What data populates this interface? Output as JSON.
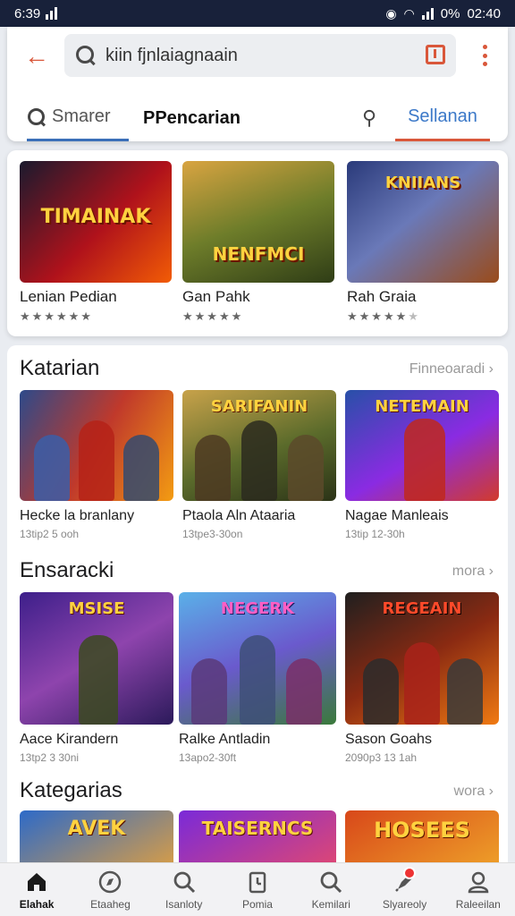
{
  "status_bar": {
    "time": "6:39",
    "battery": "0%",
    "clock": "02:40"
  },
  "header": {
    "search_value": "kiin fjnlaiagnaain",
    "tabs": {
      "search_label": "Smarer",
      "pencarian_label": "PPencarian",
      "sellanan_label": "Sellanan"
    }
  },
  "featured": {
    "items": [
      {
        "art": "TIMAINAK",
        "title": "Lenian Pedian",
        "rating": 5
      },
      {
        "art": "NENFMCI",
        "title": "Gan Pahk",
        "rating": 5
      },
      {
        "art": "KNIIANS",
        "title": "Rah Graia",
        "rating": 4.5
      }
    ]
  },
  "sections": [
    {
      "title": "Katarian",
      "more": "Finneoaradi",
      "items": [
        {
          "art": "",
          "title": "Hecke la branlany",
          "sub": "13tip2 5 ooh"
        },
        {
          "art": "SARIFANIN",
          "title": "Ptaola Aln Ataaria",
          "sub": "13tpe3-30on"
        },
        {
          "art": "NETEMAIN",
          "title": "Nagae Manleais",
          "sub": "13tip 12-30h"
        }
      ]
    },
    {
      "title": "Ensaracki",
      "more": "mora",
      "items": [
        {
          "art": "MSISE",
          "title": "Aace Kirandern",
          "sub": "13tp2 3 30ni"
        },
        {
          "art": "NEGERK",
          "title": "Ralke Antladin",
          "sub": "13apo2-30ft"
        },
        {
          "art": "REGEAIN",
          "title": "Sason Goahs",
          "sub": "2090p3 13 1ah"
        }
      ]
    },
    {
      "title": "Kategarias",
      "more": "wora",
      "items": [
        {
          "art": "AVEK",
          "title": "",
          "sub": ""
        },
        {
          "art": "TAISERNCS",
          "title": "",
          "sub": ""
        },
        {
          "art": "HOSEES",
          "title": "",
          "sub": ""
        }
      ]
    }
  ],
  "bottom_nav": [
    {
      "label": "Elahak",
      "icon": "home-icon"
    },
    {
      "label": "Etaaheg",
      "icon": "compass-icon"
    },
    {
      "label": "Isanloty",
      "icon": "search-icon"
    },
    {
      "label": "Pomia",
      "icon": "clipboard-icon"
    },
    {
      "label": "Kemilari",
      "icon": "search-icon"
    },
    {
      "label": "Slyareoly",
      "icon": "rocket-icon"
    },
    {
      "label": "Raleeilan",
      "icon": "profile-icon"
    }
  ],
  "colors": {
    "accent": "#d9573a",
    "link": "#3b78c8",
    "status_bar": "#18213a"
  }
}
